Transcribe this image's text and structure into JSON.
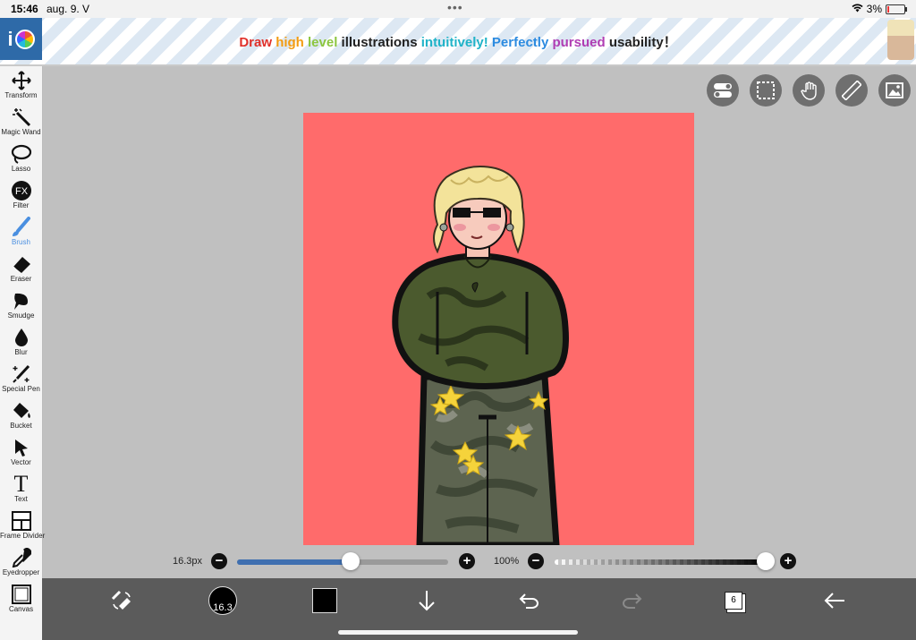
{
  "status": {
    "time": "15:46",
    "date": "aug. 9. V",
    "battery": "3%"
  },
  "banner": {
    "parts": [
      "Draw ",
      "high ",
      "level ",
      "illustrations ",
      "intuitively! ",
      "Perfectly ",
      "pursued ",
      "usability！"
    ]
  },
  "tools": [
    {
      "label": "Transform",
      "icon": "transform-icon"
    },
    {
      "label": "Magic Wand",
      "icon": "magic-wand-icon"
    },
    {
      "label": "Lasso",
      "icon": "lasso-icon"
    },
    {
      "label": "Filter",
      "icon": "fx-icon"
    },
    {
      "label": "Brush",
      "icon": "brush-icon",
      "active": true
    },
    {
      "label": "Eraser",
      "icon": "eraser-icon"
    },
    {
      "label": "Smudge",
      "icon": "smudge-icon"
    },
    {
      "label": "Blur",
      "icon": "blur-icon"
    },
    {
      "label": "Special Pen",
      "icon": "special-pen-icon"
    },
    {
      "label": "Bucket",
      "icon": "bucket-icon"
    },
    {
      "label": "Vector",
      "icon": "vector-icon"
    },
    {
      "label": "Text",
      "icon": "text-icon"
    },
    {
      "label": "Frame Divider",
      "icon": "frame-divider-icon"
    },
    {
      "label": "Eyedropper",
      "icon": "eyedropper-icon"
    },
    {
      "label": "Canvas",
      "icon": "canvas-icon"
    }
  ],
  "sliders": {
    "size_label": "16.3px",
    "size_fraction": 0.54,
    "opacity_label": "100%",
    "opacity_fraction": 1.0
  },
  "bottom": {
    "brush_size": "16.3",
    "layer_count": "6",
    "current_color": "#000000"
  },
  "colors": {
    "canvas_bg": "#ff6b6b",
    "accent": "#4a8fe0"
  }
}
